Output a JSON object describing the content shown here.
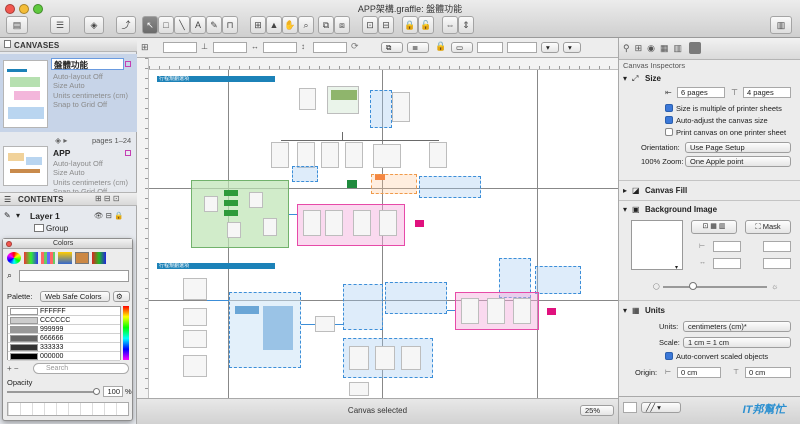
{
  "window": {
    "title": "APP架構.graffle: 盤體功能",
    "colors": {
      "close": "#f2574f",
      "minimize": "#f4bd38",
      "zoom": "#5fc93e"
    }
  },
  "sidebar": {
    "canvases_header": "CANVASES",
    "canvases": [
      {
        "name": "盤體功能",
        "details": [
          "Auto-layout Off",
          "Size Auto",
          "Units centimeters (cm)",
          "Snap to Grid Off"
        ]
      },
      {
        "name": "APP",
        "pages": "pages 1–24",
        "details": [
          "Auto-layout Off",
          "Size Auto",
          "Units centimeters (cm)",
          "Snap to Grid Off"
        ]
      }
    ],
    "contents_header": "CONTENTS",
    "layer": "Layer 1",
    "group": "Group"
  },
  "colors_panel": {
    "title": "Colors",
    "palette_label": "Palette:",
    "palette_value": "Web Safe Colors",
    "swatches": [
      "FFFFFF",
      "CCCCCC",
      "999999",
      "666666",
      "333333",
      "000000"
    ],
    "search_placeholder": "Search",
    "opacity_label": "Opacity",
    "opacity_value": "100",
    "percent": "%"
  },
  "canvas": {
    "zoom": "25%",
    "status": "Canvas selected",
    "section_labels": [
      "行程規劃選項",
      "行程規劃選項"
    ]
  },
  "inspector": {
    "title": "Canvas Inspectors",
    "size_header": "Size",
    "width_pages": "6 pages",
    "height_pages": "4 pages",
    "cb_multiple": "Size is multiple of printer sheets",
    "cb_autoadjust": "Auto-adjust the canvas size",
    "cb_print_one": "Print canvas on one printer sheet",
    "orientation_label": "Orientation:",
    "orientation_value": "Use Page Setup",
    "zoom_label": "100% Zoom:",
    "zoom_value": "One Apple point",
    "fill_header": "Canvas Fill",
    "bg_header": "Background Image",
    "mask_label": "Mask",
    "units_header": "Units",
    "units_label": "Units:",
    "units_value": "centimeters (cm)*",
    "scale_label": "Scale:",
    "scale_value": "1 cm = 1 cm",
    "cb_autoconvert": "Auto-convert scaled objects",
    "origin_label": "Origin:",
    "origin_x": "0 cm",
    "origin_y": "0 cm"
  },
  "watermark": {
    "text": "IT邦幫忙"
  }
}
